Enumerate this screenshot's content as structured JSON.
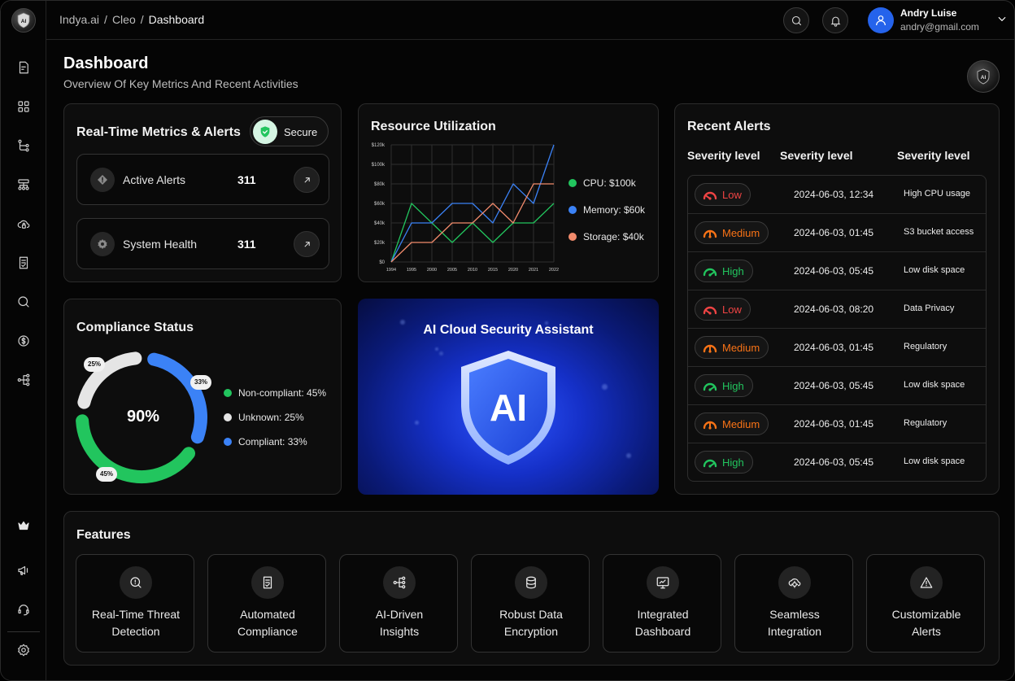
{
  "brand": {
    "logo_text": "AI"
  },
  "breadcrumb": {
    "items": [
      "Indya.ai",
      "Cleo"
    ],
    "separator": "/",
    "current": "Dashboard"
  },
  "user": {
    "name": "Andry Luise",
    "email": "andry@gmail.com"
  },
  "header": {
    "title": "Dashboard",
    "subtitle": "Overview Of Key Metrics And Recent Activities"
  },
  "sidebar": {
    "icons": [
      "report-icon",
      "grid-icon",
      "flow-icon",
      "hierarchy-icon",
      "cloud-lock-icon",
      "checklist-icon",
      "search-icon",
      "dollar-icon",
      "network-icon"
    ],
    "bottom_icons": [
      "crown-icon",
      "megaphone-icon",
      "headset-icon",
      "settings-icon"
    ]
  },
  "metrics": {
    "title": "Real-Time Metrics & Alerts",
    "status": "Secure",
    "items": [
      {
        "label": "Active Alerts",
        "value": "311",
        "icon": "alert-icon"
      },
      {
        "label": "System Health",
        "value": "311",
        "icon": "gear-icon"
      }
    ]
  },
  "resource": {
    "title": "Resource Utilization",
    "legend": [
      {
        "label": "CPU: $100k",
        "color": "#22c55e"
      },
      {
        "label": "Memory: $60k",
        "color": "#3b82f6"
      },
      {
        "label": "Storage: $40k",
        "color": "#f28b6c"
      }
    ]
  },
  "chart_data": {
    "type": "line",
    "title": "Resource Utilization",
    "x": [
      "1994",
      "1995",
      "2000",
      "2005",
      "2010",
      "2015",
      "2020",
      "2021",
      "2022"
    ],
    "ylim": [
      0,
      120000
    ],
    "yticks": [
      "$0",
      "$20k",
      "$40k",
      "$60k",
      "$80k",
      "$100k",
      "$120k"
    ],
    "grid": true,
    "legend_position": "right",
    "series": [
      {
        "name": "CPU: $100k",
        "color": "#22c55e",
        "values": [
          0,
          60000,
          40000,
          20000,
          40000,
          20000,
          40000,
          40000,
          60000
        ]
      },
      {
        "name": "Memory: $60k",
        "color": "#3b82f6",
        "values": [
          0,
          40000,
          40000,
          60000,
          60000,
          40000,
          80000,
          60000,
          120000
        ]
      },
      {
        "name": "Storage: $40k",
        "color": "#f28b6c",
        "values": [
          0,
          20000,
          20000,
          40000,
          40000,
          60000,
          40000,
          80000,
          80000
        ]
      }
    ]
  },
  "compliance": {
    "title": "Compliance Status",
    "center": "90%",
    "segments": [
      {
        "label": "Non-compliant: 45%",
        "tag": "45%",
        "value": 45,
        "color": "#22c55e"
      },
      {
        "label": "Unknown: 25%",
        "tag": "25%",
        "value": 25,
        "color": "#e5e5e5"
      },
      {
        "label": "Compliant: 33%",
        "tag": "33%",
        "value": 33,
        "color": "#3b82f6"
      }
    ]
  },
  "assistant": {
    "title": "AI Cloud Security Assistant",
    "logo_text": "AI"
  },
  "alerts": {
    "title": "Recent Alerts",
    "columns": [
      "Severity level",
      "Severity level",
      "Severity level"
    ],
    "rows": [
      {
        "severity": "Low",
        "time": "2024-06-03, 12:34",
        "desc": "High CPU usage"
      },
      {
        "severity": "Medium",
        "time": "2024-06-03, 01:45",
        "desc": "S3 bucket access"
      },
      {
        "severity": "High",
        "time": "2024-06-03, 05:45",
        "desc": "Low disk space"
      },
      {
        "severity": "Low",
        "time": "2024-06-03, 08:20",
        "desc": "Data Privacy"
      },
      {
        "severity": "Medium",
        "time": "2024-06-03, 01:45",
        "desc": "Regulatory"
      },
      {
        "severity": "High",
        "time": "2024-06-03, 05:45",
        "desc": "Low disk space"
      },
      {
        "severity": "Medium",
        "time": "2024-06-03, 01:45",
        "desc": "Regulatory"
      },
      {
        "severity": "High",
        "time": "2024-06-03, 05:45",
        "desc": "Low disk space"
      }
    ],
    "severity_colors": {
      "Low": "#ef4444",
      "Medium": "#f97316",
      "High": "#22c55e"
    }
  },
  "features": {
    "title": "Features",
    "items": [
      {
        "label": "Real-Time Threat Detection",
        "icon": "threat-search-icon"
      },
      {
        "label": "Automated Compliance",
        "icon": "document-check-icon"
      },
      {
        "label": "AI-Driven Insights",
        "icon": "network-icon"
      },
      {
        "label": "Robust Data Encryption",
        "icon": "database-icon"
      },
      {
        "label": "Integrated Dashboard",
        "icon": "monitor-icon"
      },
      {
        "label": "Seamless Integration",
        "icon": "cloud-sync-icon"
      },
      {
        "label": "Customizable Alerts",
        "icon": "warning-icon"
      }
    ]
  }
}
